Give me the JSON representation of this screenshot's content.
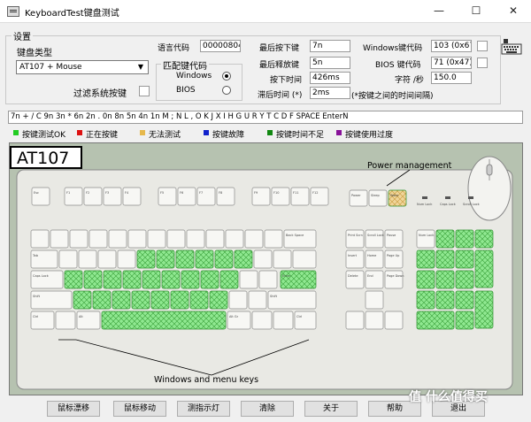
{
  "window": {
    "title": "KeyboardTest键盘测试",
    "controls": [
      "—",
      "☐",
      "✕"
    ]
  },
  "settings": {
    "group_label": "设置",
    "keyboard_type_label": "键盘类型",
    "keyboard_type_value": "AT107 + Mouse",
    "filter_label": "过滤系统按键"
  },
  "match_code": {
    "group_label": "匹配键代码",
    "options": [
      "Windows",
      "BIOS"
    ],
    "selected": "Windows"
  },
  "info": {
    "lang_code_label": "语言代码",
    "lang_code_value": "00000804",
    "last_press_label": "最后按下键",
    "last_press_value": "7n",
    "last_release_label": "最后释放键",
    "last_release_value": "5n",
    "press_time_label": "按下时间",
    "press_time_value": "426ms",
    "lag_label": "滞后时间 (*)",
    "lag_value": "2ms",
    "lag_note": "(*按键之间的时间间隔)",
    "win_code_label": "Windows键代码",
    "win_code_value": "103 (0x67)",
    "bios_code_label": "BIOS 键代码",
    "bios_code_value": "71 (0x47)",
    "char_label": "字符 /秒",
    "char_value": "150.0"
  },
  "key_log": "7n + / C 9n 3n * 6n 2n . 0n 8n 5n 4n 1n M ; N L , O K J X I H G U R Y T C D F SPACE EnterN",
  "legend": [
    {
      "label": "按键测试OK",
      "color": "#22cc22"
    },
    {
      "label": "正在按键",
      "color": "#dd1111"
    },
    {
      "label": "无法测试",
      "color": "#e6b84c"
    },
    {
      "label": "按键故障",
      "color": "#1122cc"
    },
    {
      "label": "按键时间不足",
      "color": "#118811"
    },
    {
      "label": "按键使用过度",
      "color": "#881199"
    }
  ],
  "keyboard": {
    "model": "AT107",
    "power_label": "Power management",
    "winmenu_label": "Windows and menu keys",
    "esc_label": "Esc",
    "f_keys": [
      "F1",
      "F2",
      "F3",
      "F4",
      "F5",
      "F6",
      "F7",
      "F8",
      "F9",
      "F10",
      "F11",
      "F12"
    ],
    "nav_top": [
      "Print Scrn",
      "Scroll Lock",
      "Pause"
    ],
    "nav_mid": [
      "Insert",
      "Home",
      "Page Up",
      "Delete",
      "End",
      "Page Down"
    ],
    "power_keys": [
      "Power",
      "Sleep",
      "Wake"
    ],
    "indicators": [
      "Num Lock",
      "Caps Lock",
      "Scroll Lock"
    ],
    "mod_labels": [
      "Tab",
      "Caps Lock",
      "Shift",
      "Ctrl",
      "Alt",
      "Alt Gr",
      "Ctrl",
      "Shift",
      "Enter",
      "Back Space"
    ]
  },
  "buttons": [
    "鼠标漂移",
    "鼠标移动",
    "测指示灯",
    "清除",
    "关于",
    "帮助",
    "退出"
  ],
  "watermark": "值 什么值得买"
}
